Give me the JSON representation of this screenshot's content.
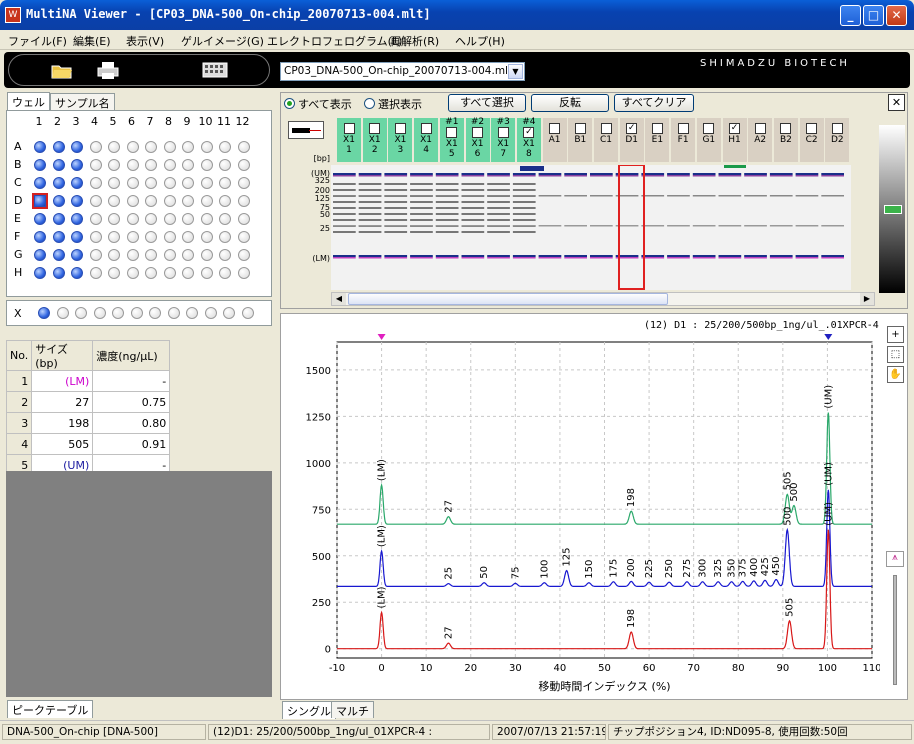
{
  "window": {
    "title": "MultiNA Viewer - [CP03_DNA-500_On-chip_20070713-004.mlt]",
    "icon": "app-icon"
  },
  "menu": [
    "ファイル(F)",
    "編集(E)",
    "表示(V)",
    "ゲルイメージ(G)",
    "エレクトロフェログラム(L)",
    "再解析(R)",
    "ヘルプ(H)"
  ],
  "toolbar": {
    "icons": [
      "open-folder-icon",
      "print-icon",
      "keyboard-icon"
    ],
    "file_select": "CP03_DNA-500_On-chip_20070713-004.mlt",
    "brand": "SHIMADZU BIOTECH"
  },
  "left_tabs": [
    "ウェル",
    "サンプル名"
  ],
  "wells": {
    "columns": [
      "1",
      "2",
      "3",
      "4",
      "5",
      "6",
      "7",
      "8",
      "9",
      "10",
      "11",
      "12"
    ],
    "rows": [
      "A",
      "B",
      "C",
      "D",
      "E",
      "F",
      "G",
      "H"
    ],
    "filled_columns": 3,
    "selected_well": "D1",
    "x_row_label": "X"
  },
  "peak_table": {
    "headers": [
      "No.",
      "サイズ(bp)",
      "濃度(ng/μL)"
    ],
    "rows": [
      [
        "1",
        "(LM)",
        "-"
      ],
      [
        "2",
        "27",
        "0.75"
      ],
      [
        "3",
        "198",
        "0.80"
      ],
      [
        "4",
        "505",
        "0.91"
      ],
      [
        "5",
        "(UM)",
        "-"
      ]
    ],
    "tab": "ピークテーブル"
  },
  "gel": {
    "radio_all": "すべて表示",
    "radio_sel": "選択表示",
    "btn_select_all": "すべて選択",
    "btn_invert": "反転",
    "btn_clear": "すべてクリア",
    "lanes": [
      {
        "tag": "",
        "name": "X1",
        "num": "1",
        "green": true,
        "checked": false
      },
      {
        "tag": "",
        "name": "X1",
        "num": "2",
        "green": true,
        "checked": false
      },
      {
        "tag": "",
        "name": "X1",
        "num": "3",
        "green": true,
        "checked": false
      },
      {
        "tag": "",
        "name": "X1",
        "num": "4",
        "green": true,
        "checked": false
      },
      {
        "tag": "#1",
        "name": "X1",
        "num": "5",
        "green": true,
        "checked": false
      },
      {
        "tag": "#2",
        "name": "X1",
        "num": "6",
        "green": true,
        "checked": false
      },
      {
        "tag": "#3",
        "name": "X1",
        "num": "7",
        "green": true,
        "checked": false
      },
      {
        "tag": "#4",
        "name": "X1",
        "num": "8",
        "green": true,
        "checked": true
      },
      {
        "tag": "",
        "name": "A1",
        "num": "",
        "green": false,
        "checked": false
      },
      {
        "tag": "",
        "name": "B1",
        "num": "",
        "green": false,
        "checked": false
      },
      {
        "tag": "",
        "name": "C1",
        "num": "",
        "green": false,
        "checked": false
      },
      {
        "tag": "",
        "name": "D1",
        "num": "",
        "green": false,
        "checked": true
      },
      {
        "tag": "",
        "name": "E1",
        "num": "",
        "green": false,
        "checked": false
      },
      {
        "tag": "",
        "name": "F1",
        "num": "",
        "green": false,
        "checked": false
      },
      {
        "tag": "",
        "name": "G1",
        "num": "",
        "green": false,
        "checked": false
      },
      {
        "tag": "",
        "name": "H1",
        "num": "",
        "green": false,
        "checked": true
      },
      {
        "tag": "",
        "name": "A2",
        "num": "",
        "green": false,
        "checked": false
      },
      {
        "tag": "",
        "name": "B2",
        "num": "",
        "green": false,
        "checked": false
      },
      {
        "tag": "",
        "name": "C2",
        "num": "",
        "green": false,
        "checked": false
      },
      {
        "tag": "",
        "name": "D2",
        "num": "",
        "green": false,
        "checked": false
      }
    ],
    "axis_labels": [
      "[bp]",
      "(UM)",
      "325",
      "200",
      "125",
      "75",
      "50",
      "25",
      "(LM)"
    ]
  },
  "chart_tabs": [
    "シングル",
    "マルチ"
  ],
  "chart_data": {
    "type": "line",
    "title": "(12) D1 : 25/200/500bp_1ng/ul_.01XPCR-4",
    "xlabel": "移動時間インデックス (%)",
    "ylabel": "",
    "xlim": [
      -10,
      110
    ],
    "ylim": [
      -50,
      1650
    ],
    "xticks": [
      -10,
      0,
      10,
      20,
      30,
      40,
      50,
      60,
      70,
      80,
      90,
      100,
      110
    ],
    "yticks": [
      0,
      250,
      500,
      750,
      1000,
      1250,
      1500
    ],
    "series": [
      {
        "color": "#2aa86a",
        "baseline": 670,
        "peaks": [
          [
            0,
            880,
            "(LM)"
          ],
          [
            15,
            710,
            "27"
          ],
          [
            56,
            740,
            "198"
          ],
          [
            91,
            830,
            "505"
          ],
          [
            92.5,
            770,
            "500"
          ],
          [
            100.2,
            1270,
            "(UM)"
          ]
        ]
      },
      {
        "color": "#1818d0",
        "baseline": 335,
        "peaks": [
          [
            0,
            525,
            "(LM)"
          ],
          [
            15,
            350,
            "25"
          ],
          [
            23,
            355,
            "50"
          ],
          [
            30,
            352,
            "75"
          ],
          [
            36.5,
            355,
            "100"
          ],
          [
            41.5,
            420,
            "125"
          ],
          [
            46.5,
            355,
            "150"
          ],
          [
            52,
            360,
            "175"
          ],
          [
            56,
            362,
            "200"
          ],
          [
            60,
            358,
            "225"
          ],
          [
            64.5,
            358,
            "250"
          ],
          [
            68.5,
            360,
            "275"
          ],
          [
            72,
            360,
            "300"
          ],
          [
            75.5,
            360,
            "325"
          ],
          [
            78.5,
            360,
            "350"
          ],
          [
            81,
            362,
            "375"
          ],
          [
            83.5,
            365,
            "400"
          ],
          [
            86,
            368,
            "425"
          ],
          [
            88.5,
            372,
            "450"
          ],
          [
            91,
            640,
            "500"
          ],
          [
            100.2,
            855,
            "(UM)"
          ]
        ]
      },
      {
        "color": "#d81818",
        "baseline": 0,
        "peaks": [
          [
            0,
            195,
            "(LM)"
          ],
          [
            15,
            30,
            "27"
          ],
          [
            56,
            90,
            "198"
          ],
          [
            91.5,
            150,
            "505"
          ],
          [
            100.2,
            640,
            "(UM)"
          ]
        ]
      }
    ]
  },
  "status": {
    "method": "DNA-500_On-chip [DNA-500]",
    "sample": "(12)D1: 25/200/500bp_1ng/ul_01XPCR-4 :",
    "datetime": "2007/07/13 21:57:19",
    "chip": "チップポジション4, ID:ND095-8, 使用回数:50回"
  }
}
